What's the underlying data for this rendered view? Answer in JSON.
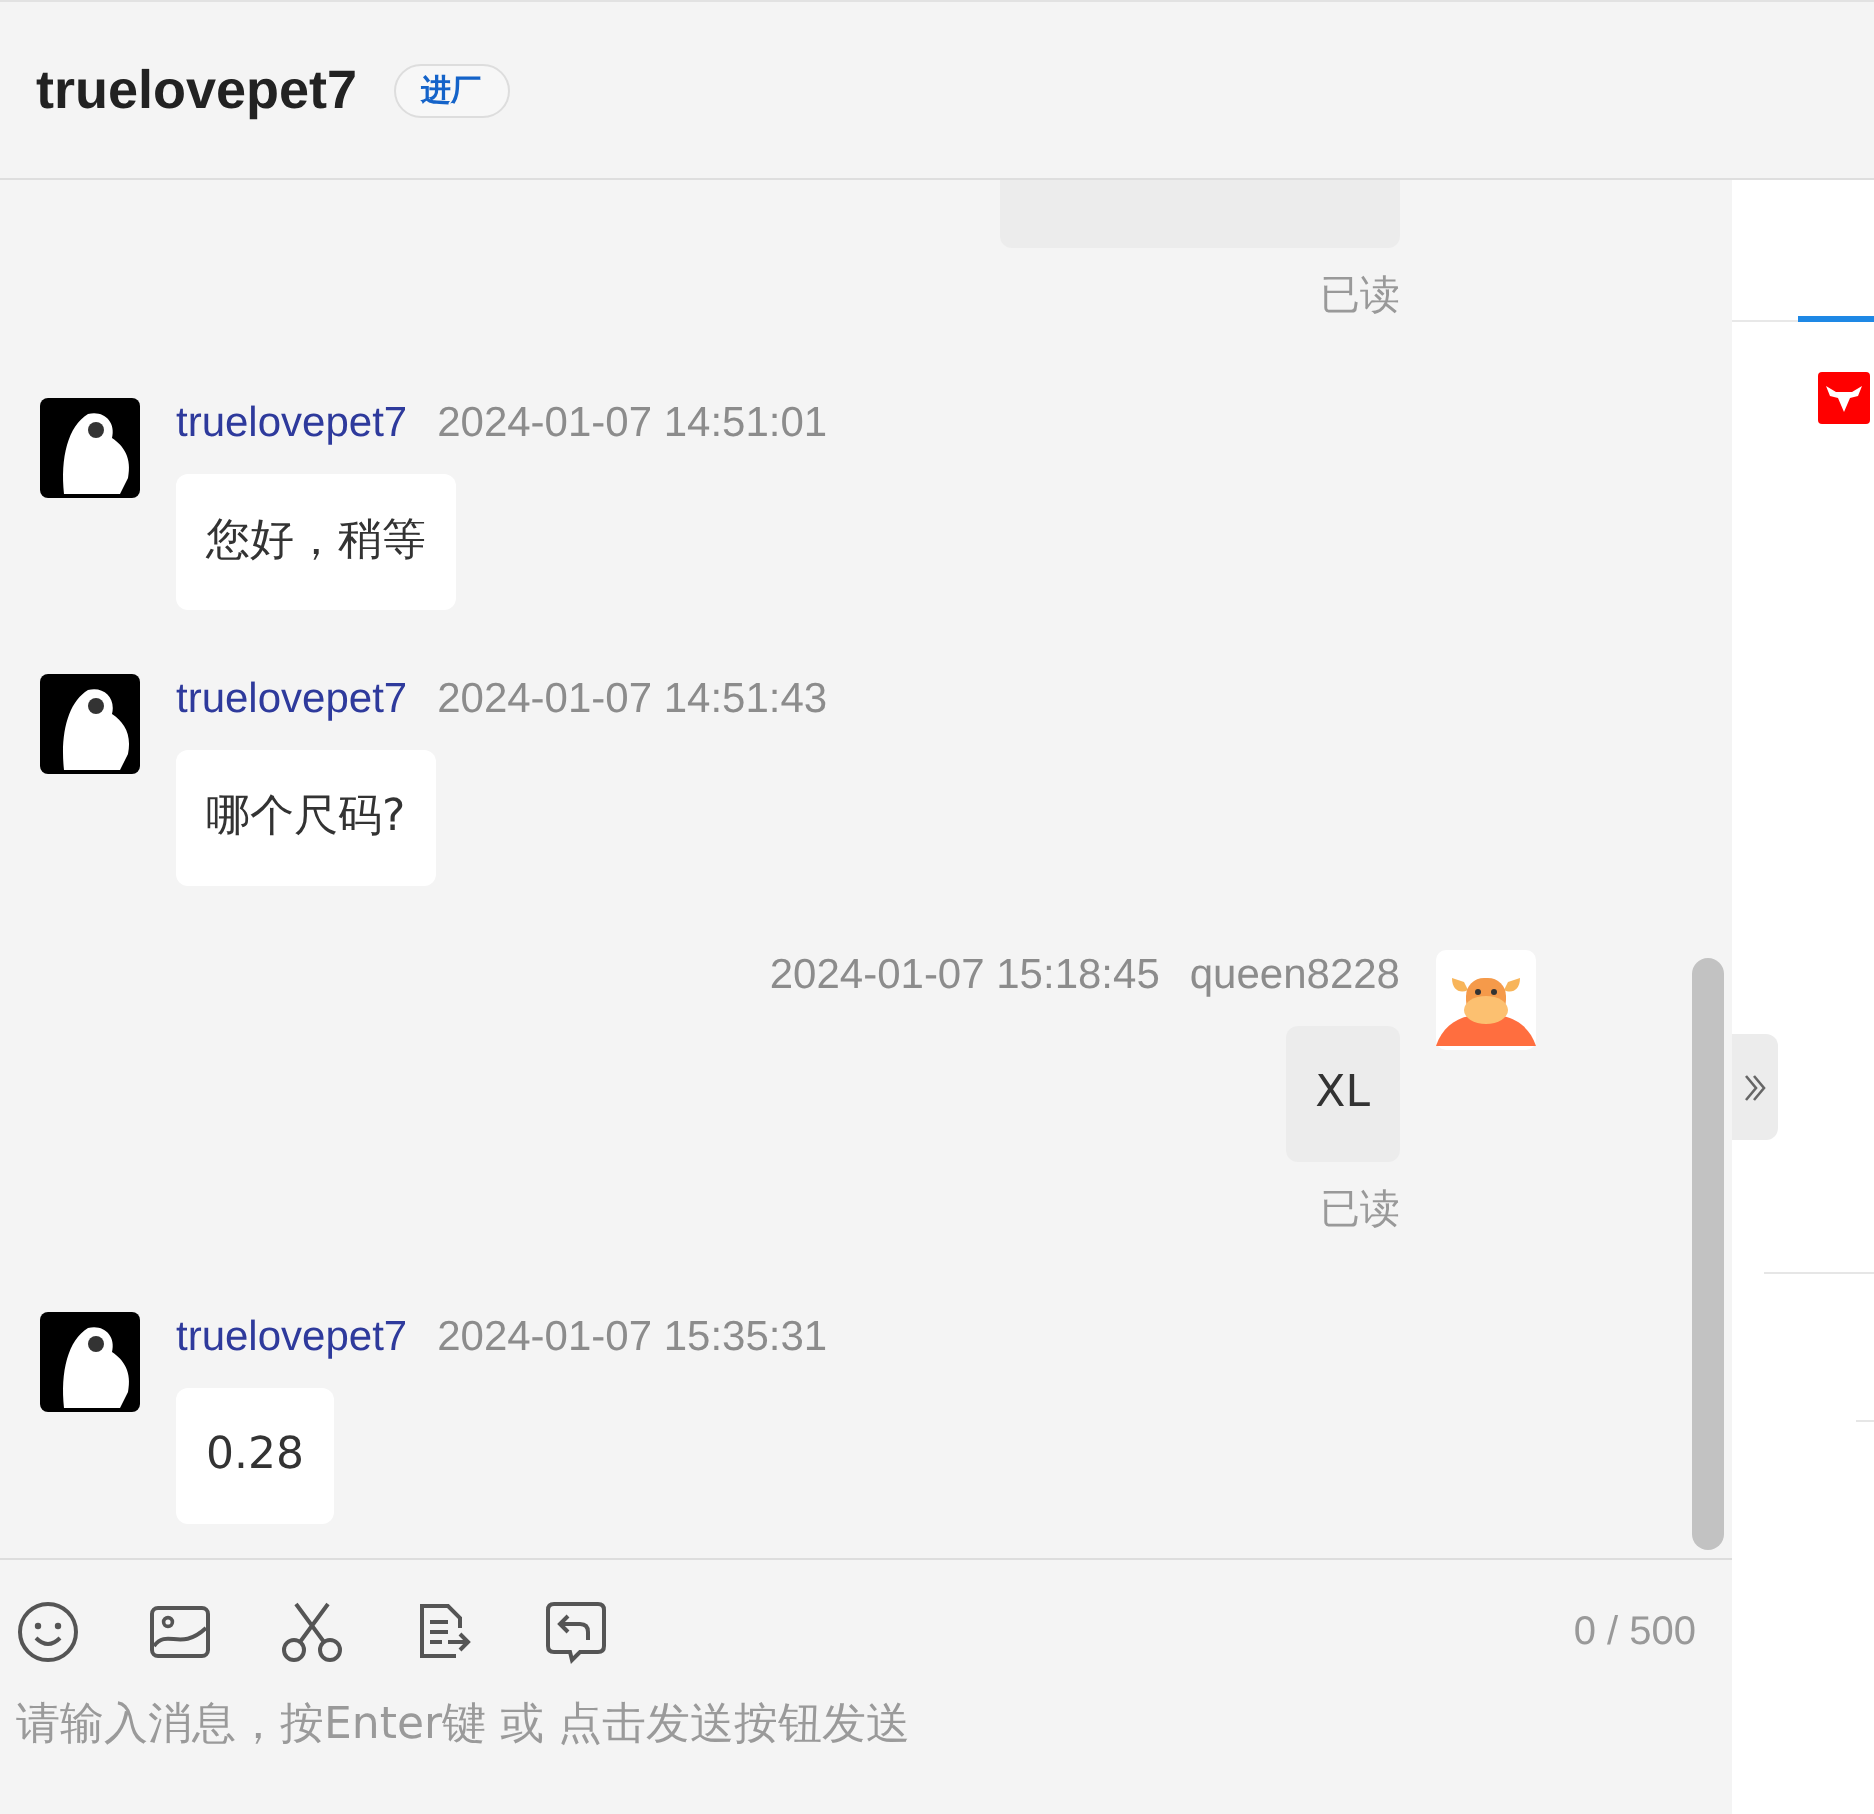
{
  "header": {
    "title": "truelovepet7",
    "tag": "进厂"
  },
  "messages": [
    {
      "kind": "self",
      "status": "已读"
    },
    {
      "kind": "other",
      "sender": "truelovepet7",
      "time": "2024-01-07 14:51:01",
      "text": "您好，稍等"
    },
    {
      "kind": "other",
      "sender": "truelovepet7",
      "time": "2024-01-07 14:51:43",
      "text": "哪个尺码?"
    },
    {
      "kind": "self",
      "sender": "queen8228",
      "time": "2024-01-07 15:18:45",
      "text": "XL",
      "status": "已读"
    },
    {
      "kind": "other",
      "sender": "truelovepet7",
      "time": "2024-01-07 15:35:31",
      "text": "0.28"
    }
  ],
  "composer": {
    "counter": "0 / 500",
    "placeholder": "请输入消息，按Enter键 或 点击发送按钮发送"
  }
}
